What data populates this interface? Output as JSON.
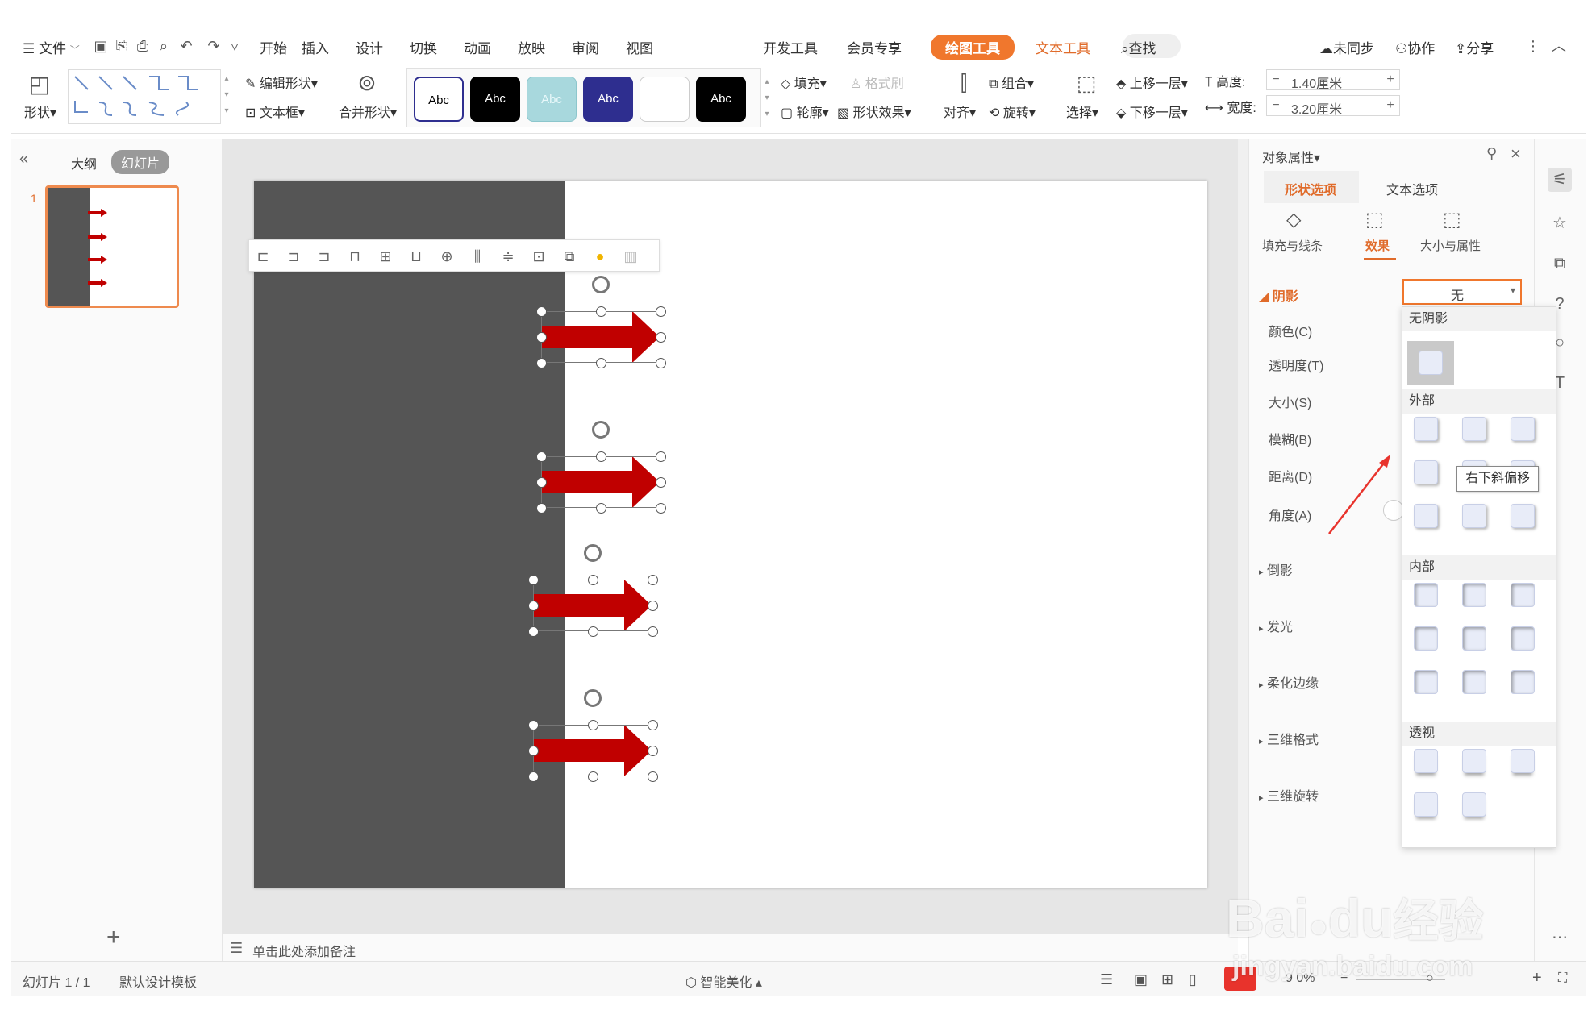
{
  "menu": {
    "file": "文件",
    "items": [
      "开始",
      "插入",
      "设计",
      "切换",
      "动画",
      "放映",
      "审阅",
      "视图",
      "开发工具",
      "会员专享"
    ],
    "drawing_tools": "绘图工具",
    "text_tools": "文本工具",
    "search": "查找",
    "not_synced": "未同步",
    "collaborate": "协作",
    "share": "分享"
  },
  "ribbon": {
    "shape": "形状",
    "edit_shape": "编辑形状",
    "text_box": "文本框",
    "merge_shapes": "合并形状",
    "style_label": "Abc",
    "fill": "填充",
    "format_painter": "格式刷",
    "outline": "轮廓",
    "shape_effects": "形状效果",
    "align": "对齐",
    "group": "组合",
    "rotate": "旋转",
    "select": "选择",
    "bring_forward": "上移一层",
    "send_backward": "下移一层",
    "height_label": "高度:",
    "height_value": "1.40厘米",
    "width_label": "宽度:",
    "width_value": "3.20厘米",
    "colors": {
      "style1": "#ffffff",
      "style2": "#000000",
      "style3": "#a8d8dd",
      "style4": "#2e2e8f",
      "style5": "#ffffff",
      "style6": "#000000"
    }
  },
  "left_panel": {
    "outline_tab": "大纲",
    "slides_tab": "幻灯片",
    "slide_number": "1",
    "add": "+"
  },
  "notes": {
    "placeholder": "单击此处添加备注"
  },
  "props": {
    "title": "对象属性",
    "tab_shape": "形状选项",
    "tab_text": "文本选项",
    "sub_fill": "填充与线条",
    "sub_effects": "效果",
    "sub_size": "大小与属性",
    "shadow": "阴影",
    "shadow_value": "无",
    "color": "颜色(C)",
    "transparency": "透明度(T)",
    "size": "大小(S)",
    "blur": "模糊(B)",
    "distance": "距离(D)",
    "angle": "角度(A)",
    "reflection": "倒影",
    "glow": "发光",
    "soft_edges": "柔化边缘",
    "format_3d": "三维格式",
    "rotation_3d": "三维旋转"
  },
  "dropdown": {
    "no_shadow": "无阴影",
    "outer": "外部",
    "inner": "内部",
    "perspective": "透视",
    "tooltip": "右下斜偏移"
  },
  "status": {
    "slide_count": "幻灯片 1 / 1",
    "template": "默认设计模板",
    "beautify": "智能美化",
    "zoom": "9 0%"
  },
  "watermark": {
    "brand": "Bai",
    "brand2": "du",
    "cn": "经验",
    "url": "jingyan.baidu.com"
  },
  "slide_colors": {
    "dark": "#555555",
    "arrow": "#c00000",
    "accent": "#f0772d"
  }
}
